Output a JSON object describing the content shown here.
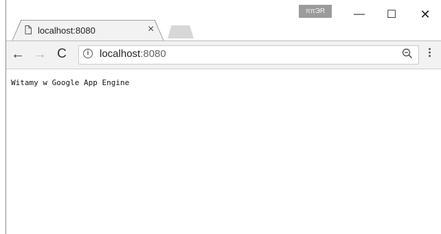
{
  "window": {
    "extension_badge": "ππЭR",
    "minimize_symbol": "—",
    "maximize_symbol": "☐",
    "close_symbol": "✕"
  },
  "tab": {
    "title": "localhost:8080",
    "icon": "page-icon",
    "close_symbol": "×"
  },
  "toolbar": {
    "back_symbol": "←",
    "forward_symbol": "→",
    "reload_symbol": "C",
    "address": {
      "host": "localhost",
      "port": ":8080",
      "security_icon": "info-icon",
      "zoom_icon": "zoom-out-icon",
      "menu_icon": "menu-icon"
    }
  },
  "page": {
    "text": "Witamy w Google App Engine"
  }
}
